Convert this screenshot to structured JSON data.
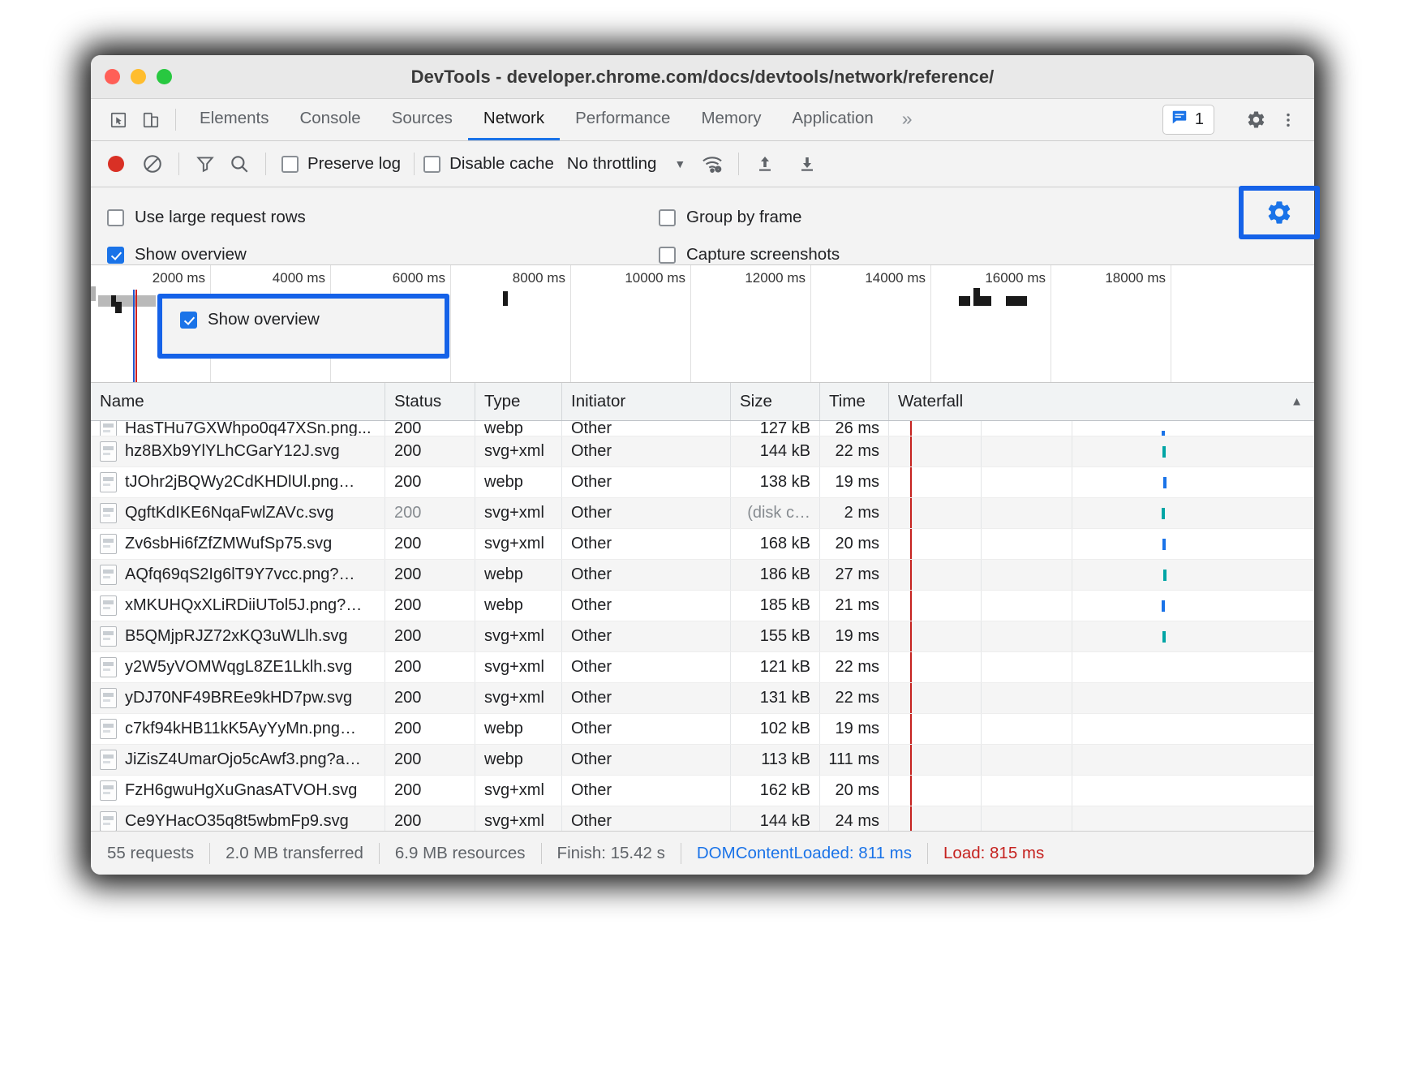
{
  "window": {
    "title": "DevTools - developer.chrome.com/docs/devtools/network/reference/",
    "traffic_lights": [
      "close",
      "minimize",
      "zoom"
    ]
  },
  "tabstrip": {
    "inspect_icon": "cursor-inspect-icon",
    "device_icon": "device-toggle-icon",
    "tabs": [
      {
        "label": "Elements",
        "active": false
      },
      {
        "label": "Console",
        "active": false
      },
      {
        "label": "Sources",
        "active": false
      },
      {
        "label": "Network",
        "active": true
      },
      {
        "label": "Performance",
        "active": false
      },
      {
        "label": "Memory",
        "active": false
      },
      {
        "label": "Application",
        "active": false
      }
    ],
    "more_label": "»",
    "issues_count": "1",
    "issues_icon": "issues-message-icon",
    "settings_icon": "gear-icon",
    "kebab_icon": "more-vertical-icon"
  },
  "toolbar": {
    "record_icon": "record-button",
    "clear_icon": "clear-no-entry-icon",
    "filter_icon": "filter-funnel-icon",
    "search_icon": "search-icon",
    "preserve_log_label": "Preserve log",
    "preserve_log_checked": false,
    "disable_cache_label": "Disable cache",
    "disable_cache_checked": false,
    "throttling_label": "No throttling",
    "throttle_caret": "▼",
    "wifi_icon": "network-conditions-icon",
    "import_icon": "upload-har-icon",
    "export_icon": "download-har-icon",
    "settings_gear_icon": "gear-icon"
  },
  "settings_pane": {
    "left": [
      {
        "label": "Use large request rows",
        "checked": false
      },
      {
        "label": "Show overview",
        "checked": true
      }
    ],
    "right": [
      {
        "label": "Group by frame",
        "checked": false
      },
      {
        "label": "Capture screenshots",
        "checked": false
      }
    ]
  },
  "overview": {
    "ticks": [
      "2000 ms",
      "4000 ms",
      "6000 ms",
      "8000 ms",
      "10000 ms",
      "12000 ms",
      "14000 ms",
      "16000 ms",
      "18000 ms"
    ],
    "dom_content_loaded_marker_color": "#2255cc",
    "load_marker_color": "#d02020"
  },
  "table": {
    "columns": [
      "Name",
      "Status",
      "Type",
      "Initiator",
      "Size",
      "Time",
      "Waterfall"
    ],
    "sort_column": "Waterfall",
    "sort_arrow": "▲",
    "rows": [
      {
        "name": "HasTHu7GXWhpo0q47XSn.png...",
        "status": "200",
        "type": "webp",
        "initiator": "Other",
        "size": "127 kB",
        "time": "26 ms",
        "clipped": true
      },
      {
        "name": "hz8BXb9YlYLhCGarY12J.svg",
        "status": "200",
        "type": "svg+xml",
        "initiator": "Other",
        "size": "144 kB",
        "time": "22 ms"
      },
      {
        "name": "tJOhr2jBQWy2CdKHDlUl.png…",
        "status": "200",
        "type": "webp",
        "initiator": "Other",
        "size": "138 kB",
        "time": "19 ms"
      },
      {
        "name": "QgftKdIKE6NqaFwlZAVc.svg",
        "status": "200",
        "type": "svg+xml",
        "initiator": "Other",
        "size": "(disk c…",
        "time": "2 ms",
        "cached": true
      },
      {
        "name": "Zv6sbHi6fZfZMWufSp75.svg",
        "status": "200",
        "type": "svg+xml",
        "initiator": "Other",
        "size": "168 kB",
        "time": "20 ms"
      },
      {
        "name": "AQfq69qS2Ig6lT9Y7vcc.png?…",
        "status": "200",
        "type": "webp",
        "initiator": "Other",
        "size": "186 kB",
        "time": "27 ms"
      },
      {
        "name": "xMKUHQxXLiRDiiUTol5J.png?…",
        "status": "200",
        "type": "webp",
        "initiator": "Other",
        "size": "185 kB",
        "time": "21 ms"
      },
      {
        "name": "B5QMjpRJZ72xKQ3uWLlh.svg",
        "status": "200",
        "type": "svg+xml",
        "initiator": "Other",
        "size": "155 kB",
        "time": "19 ms"
      },
      {
        "name": "y2W5yVOMWqgL8ZE1Lklh.svg",
        "status": "200",
        "type": "svg+xml",
        "initiator": "Other",
        "size": "121 kB",
        "time": "22 ms"
      },
      {
        "name": "yDJ70NF49BREe9kHD7pw.svg",
        "status": "200",
        "type": "svg+xml",
        "initiator": "Other",
        "size": "131 kB",
        "time": "22 ms"
      },
      {
        "name": "c7kf94kHB11kK5AyYyMn.png…",
        "status": "200",
        "type": "webp",
        "initiator": "Other",
        "size": "102 kB",
        "time": "19 ms"
      },
      {
        "name": "JiZisZ4UmarOjo5cAwf3.png?a…",
        "status": "200",
        "type": "webp",
        "initiator": "Other",
        "size": "113 kB",
        "time": "111 ms"
      },
      {
        "name": "FzH6gwuHgXuGnasATVOH.svg",
        "status": "200",
        "type": "svg+xml",
        "initiator": "Other",
        "size": "162 kB",
        "time": "20 ms"
      },
      {
        "name": "Ce9YHacO35q8t5wbmFp9.svg",
        "status": "200",
        "type": "svg+xml",
        "initiator": "Other",
        "size": "144 kB",
        "time": "24 ms"
      }
    ]
  },
  "statusbar": {
    "requests": "55 requests",
    "transferred": "2.0 MB transferred",
    "resources": "6.9 MB resources",
    "finish": "Finish: 15.42 s",
    "dom_content_loaded": "DOMContentLoaded: 811 ms",
    "load": "Load: 815 ms"
  },
  "highlights": {
    "gear_box": "network-settings-gear-highlight",
    "show_overview_box": "show-overview-checkbox-highlight"
  },
  "colors": {
    "accent_blue": "#1a73e8",
    "highlight_blue": "#1562e8",
    "red": "#c5221f",
    "record_red": "#d93025"
  }
}
